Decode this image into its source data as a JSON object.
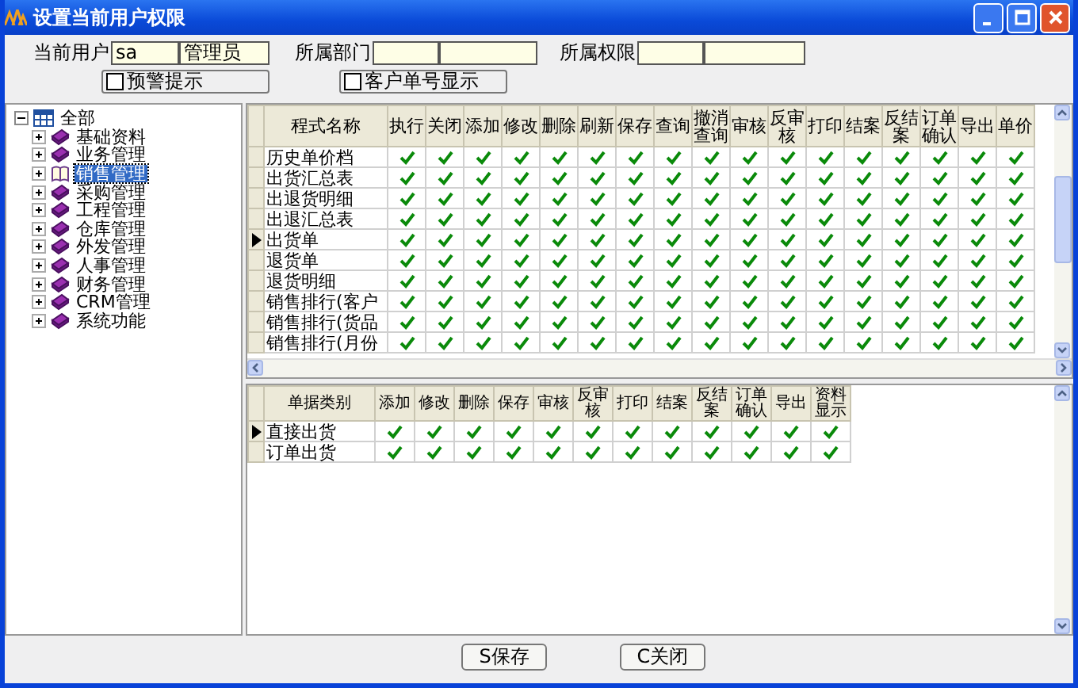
{
  "window": {
    "title": "设置当前用户权限"
  },
  "user": {
    "label": "当前用户",
    "fields": [
      {
        "value": "sa"
      },
      {
        "value": "管理员"
      }
    ]
  },
  "dept": {
    "label": "所属部门"
  },
  "role": {
    "label": "所属权限"
  },
  "options": [
    {
      "label": "预警提示",
      "checked": false
    },
    {
      "label": "客户单号显示",
      "checked": false
    }
  ],
  "tree": {
    "label": "全部",
    "expanded": true,
    "children": [
      {
        "label": "基础资料",
        "expanded": false,
        "selected": false
      },
      {
        "label": "业务管理",
        "expanded": false,
        "selected": false
      },
      {
        "label": "销售管理",
        "expanded": false,
        "selected": true
      },
      {
        "label": "采购管理",
        "expanded": false,
        "selected": false
      },
      {
        "label": "工程管理",
        "expanded": false,
        "selected": false
      },
      {
        "label": "仓库管理",
        "expanded": false,
        "selected": false
      },
      {
        "label": "外发管理",
        "expanded": false,
        "selected": false
      },
      {
        "label": "人事管理",
        "expanded": false,
        "selected": false
      },
      {
        "label": "财务管理",
        "expanded": false,
        "selected": false
      },
      {
        "label": "CRM管理",
        "expanded": false,
        "selected": false
      },
      {
        "label": "系统功能",
        "expanded": false,
        "selected": false
      }
    ]
  },
  "program_grid": {
    "columns": [
      "程式名称",
      "执行",
      "关闭",
      "添加",
      "修改",
      "删除",
      "刷新",
      "保存",
      "查询",
      "撤消查询",
      "审核",
      "反审核",
      "打印",
      "结案",
      "反结案",
      "订单确认",
      "导出",
      "单价"
    ],
    "rows": [
      {
        "name": "历史单价档",
        "selected": false,
        "checks": [
          true,
          true,
          true,
          true,
          true,
          true,
          true,
          true,
          true,
          true,
          true,
          true,
          true,
          true,
          true,
          true,
          true
        ]
      },
      {
        "name": "出货汇总表",
        "selected": false,
        "checks": [
          true,
          true,
          true,
          true,
          true,
          true,
          true,
          true,
          true,
          true,
          true,
          true,
          true,
          true,
          true,
          true,
          true
        ]
      },
      {
        "name": "出退货明细",
        "selected": false,
        "checks": [
          true,
          true,
          true,
          true,
          true,
          true,
          true,
          true,
          true,
          true,
          true,
          true,
          true,
          true,
          true,
          true,
          true
        ]
      },
      {
        "name": "出退汇总表",
        "selected": false,
        "checks": [
          true,
          true,
          true,
          true,
          true,
          true,
          true,
          true,
          true,
          true,
          true,
          true,
          true,
          true,
          true,
          true,
          true
        ]
      },
      {
        "name": "出货单",
        "selected": true,
        "checks": [
          true,
          true,
          true,
          true,
          true,
          true,
          true,
          true,
          true,
          true,
          true,
          true,
          true,
          true,
          true,
          true,
          true
        ]
      },
      {
        "name": "退货单",
        "selected": false,
        "checks": [
          true,
          true,
          true,
          true,
          true,
          true,
          true,
          true,
          true,
          true,
          true,
          true,
          true,
          true,
          true,
          true,
          true
        ]
      },
      {
        "name": "退货明细",
        "selected": false,
        "checks": [
          true,
          true,
          true,
          true,
          true,
          true,
          true,
          true,
          true,
          true,
          true,
          true,
          true,
          true,
          true,
          true,
          true
        ]
      },
      {
        "name": "销售排行(客户",
        "selected": false,
        "checks": [
          true,
          true,
          true,
          true,
          true,
          true,
          true,
          true,
          true,
          true,
          true,
          true,
          true,
          true,
          true,
          true,
          true
        ]
      },
      {
        "name": "销售排行(货品",
        "selected": false,
        "checks": [
          true,
          true,
          true,
          true,
          true,
          true,
          true,
          true,
          true,
          true,
          true,
          true,
          true,
          true,
          true,
          true,
          true
        ]
      },
      {
        "name": "销售排行(月份",
        "selected": false,
        "checks": [
          true,
          true,
          true,
          true,
          true,
          true,
          true,
          true,
          true,
          true,
          true,
          true,
          true,
          true,
          true,
          true,
          true
        ]
      }
    ]
  },
  "document_grid": {
    "columns": [
      "单据类别",
      "添加",
      "修改",
      "删除",
      "保存",
      "审核",
      "反审核",
      "打印",
      "结案",
      "反结案",
      "订单确认",
      "导出",
      "资料显示"
    ],
    "rows": [
      {
        "name": "直接出货",
        "selected": true,
        "checks": [
          true,
          true,
          true,
          true,
          true,
          true,
          true,
          true,
          true,
          true,
          true,
          true
        ]
      },
      {
        "name": "订单出货",
        "selected": false,
        "checks": [
          true,
          true,
          true,
          true,
          true,
          true,
          true,
          true,
          true,
          true,
          true,
          true
        ]
      }
    ]
  },
  "buttons": [
    {
      "label": "S保存"
    },
    {
      "label": "C关闭"
    }
  ]
}
